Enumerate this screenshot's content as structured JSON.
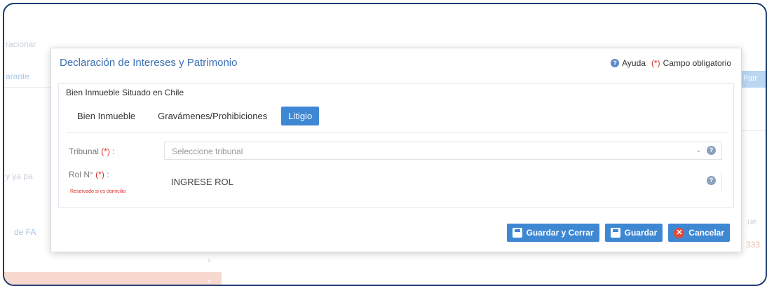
{
  "background": {
    "fragments": [
      "racionar",
      "arante",
      "y ya pa",
      "de FA",
      "Patr",
      "ue",
      "333"
    ]
  },
  "dialog": {
    "title": "Declaración de Intereses y Patrimonio",
    "help_label": "Ayuda",
    "required_mark": "(*)",
    "required_label": "Campo obligatorio",
    "section_title": "Bien Inmueble Situado en Chile",
    "tabs": [
      {
        "label": "Bien Inmueble",
        "active": false
      },
      {
        "label": "Gravámenes/Prohibiciones",
        "active": false
      },
      {
        "label": "Litigio",
        "active": true
      }
    ],
    "fields": {
      "tribunal": {
        "label": "Tribunal",
        "req": "(*)",
        "suffix": ":",
        "placeholder": "Seleccione tribunal"
      },
      "rol": {
        "label": "Rol N°",
        "req": "(*)",
        "suffix": ":",
        "note": "Reservado si es domicilio",
        "value": "INGRESE ROL"
      }
    },
    "buttons": {
      "save_close": "Guardar y Cerrar",
      "save": "Guardar",
      "cancel": "Cancelar"
    }
  },
  "colors": {
    "primary": "#3e87d3",
    "title": "#3b6fb2",
    "required": "#d9302a",
    "cancel_icon": "#e04a3c"
  }
}
